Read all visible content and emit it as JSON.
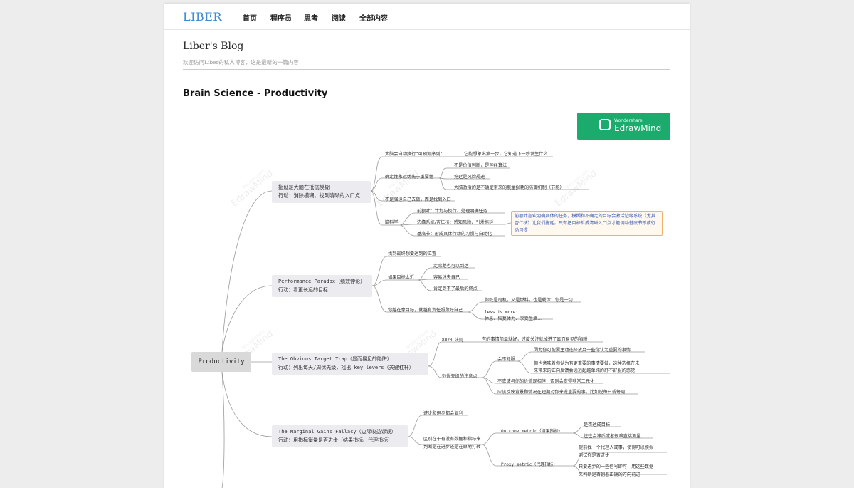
{
  "nav": {
    "brand": "LIBER",
    "links": [
      "首页",
      "程序员",
      "思考",
      "阅读",
      "全部内容"
    ]
  },
  "blog": {
    "title": "Liber's Blog",
    "subtitle": "欢迎访问Liber的私人博客，这是最新的一篇内容"
  },
  "post": {
    "title": "Brain Science - Productivity"
  },
  "mindmap": {
    "brand_small": "Wondershare",
    "brand_name": "EdrawMind",
    "watermark": "EdrawMind",
    "watermark_small": "Wondershare",
    "root": "Productivity",
    "branches": [
      {
        "line1": "拖延是大脑在抵抗模糊",
        "line2": "行动：消除模糊，找到清晰的入口点"
      },
      {
        "line1": "Performance Paradox（绩效悖论）",
        "line2": "行动：看更长远的目标"
      },
      {
        "line1": "The Obvious Target Trap（显而易见的陷阱）",
        "line2": "行动：列出每天/周优先级，找出 key levers（关键杠杆）"
      },
      {
        "line1": "The Marginal Gains Fallacy（边际收益谬误）",
        "line2": "行动：用指标衡量是否进步（结果指标、代理指标）"
      }
    ],
    "labels": {
      "b1_predict": "大脑会自动执行“可预测序列”",
      "b1_predict_sub": "它能想象出第一步，它知道下一秒发生什么",
      "b1_certainty": "确定性永远优先于重要性",
      "b1_c1": "不是价值判断，是神经算法",
      "b1_c2": "拖延是风险规避",
      "b1_c3": "大脑激活的是不确定带来的能量损耗的防御机制（节能）",
      "b1_entry": "不是强迫自己去做，而是找到入口",
      "b1_neuro": "脑科学",
      "b1_n1": "前额叶：计划与执行、处理明确任务",
      "b1_n2": "边缘系统/杏仁核：感知风险、引发拖延",
      "b1_n3": "基底节：形成具体行动的习惯与自动化",
      "b1_note": "前额叶喜欢明确具体的任务，模糊和不确定的目标会激活边缘系统（尤其杏仁核）让我们拖延。只有把目标拆成清晰入口点才能调动基底节形成行动习惯",
      "b2_pos": "找到最终想要达到的位置",
      "b2_far": "如果目标太近",
      "b2_f1": "走弯路也可以到达",
      "b2_f2": "容易迷失自己",
      "b2_f3": "肯定到不了最后的终点",
      "b2_care": "你越在意目标，就越有责任照顾好自己",
      "b2_c1": "你既是司机，又是燃料，也是载体：你是一切",
      "b2_c2a": "less is more:",
      "b2_c2b": "休息、恢复体力、享受生活...",
      "b3_8020": "8020 法则",
      "b3_8020_sub": "有的事情简单就好，过度关注就掉进了显而易见的陷阱",
      "b3_priority": "列优先级的注意点",
      "b3_uncomf": "会不舒服",
      "b3_u1": "因为你可能要主动选择放弃一些你认为重要的事情",
      "b3_u2a": "但也意味着你认为有更重要的事情要做，这种选择在未",
      "b3_u2b": "来带来的正向反馈会远远超越单纯的舒不舒服的感觉",
      "b3_p2": "不应该与你的价值观相悖，否则会变得非常二元化",
      "b3_p3": "应该反映背景和情况在短期对你来说重要的事，比如说每日或每周",
      "b4_compound": "进步和退步都会复利",
      "b4_dist_a": "区别在于有没有数据和指标来",
      "b4_dist_b": "判断是在进步还是在原地打转",
      "b4_outcome": "Outcome metric（结果指标）",
      "b4_o1": "是否达成目标",
      "b4_o2": "往往会滞后或者很难直接测量",
      "b4_proxy": "Proxy metric（代理指标）",
      "b4_p1a": "提前找一个代理人或事，使得可以模拟",
      "b4_p1b": "测试你是否进步",
      "b4_p2a": "只要进步的一些信号即可，用这些数据",
      "b4_p2b": "来判断是否朝着正确的方向前进"
    }
  },
  "colors": {
    "brand": "#3b8ad6",
    "edraw_green": "#1bab6d",
    "note_border": "#f0b26a",
    "note_text": "#3b5bb6",
    "node_bg": "#ebebf0",
    "root_bg": "#d9d9d9"
  }
}
